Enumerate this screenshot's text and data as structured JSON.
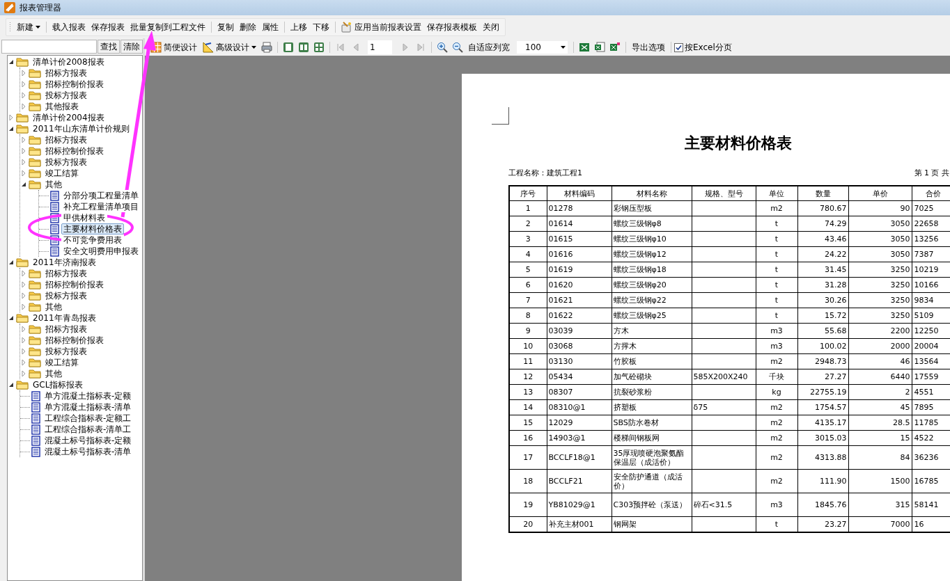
{
  "window": {
    "title": "报表管理器"
  },
  "toolbar": [
    [
      {
        "label": "新建",
        "kind": "menu"
      }
    ],
    [
      {
        "label": "载入报表",
        "kind": "text"
      },
      {
        "label": "保存报表",
        "kind": "text"
      },
      {
        "label": "批量复制到工程文件",
        "kind": "text"
      }
    ],
    [
      {
        "label": "复制",
        "kind": "text"
      },
      {
        "label": "删除",
        "kind": "text"
      },
      {
        "label": "属性",
        "kind": "text"
      }
    ],
    [
      {
        "label": "上移",
        "kind": "text"
      },
      {
        "label": "下移",
        "kind": "text"
      }
    ],
    [
      {
        "label": "应用当前报表设置",
        "kind": "icon"
      },
      {
        "label": "保存报表模板",
        "kind": "text"
      },
      {
        "label": "关闭",
        "kind": "text"
      }
    ]
  ],
  "search": {
    "find": "查找",
    "clear": "清除"
  },
  "tree": [
    {
      "label": "清单计价2008报表",
      "kind": "folder",
      "expanded": true,
      "selected": false,
      "children": [
        {
          "label": "招标方报表",
          "kind": "folder",
          "expanded": false,
          "selected": false
        },
        {
          "label": "招标控制价报表",
          "kind": "folder",
          "expanded": false,
          "selected": false
        },
        {
          "label": "投标方报表",
          "kind": "folder",
          "expanded": false,
          "selected": false
        },
        {
          "label": "其他报表",
          "kind": "folder",
          "expanded": false,
          "selected": false
        }
      ]
    },
    {
      "label": "清单计价2004报表",
      "kind": "folder",
      "expanded": false,
      "selected": false
    },
    {
      "label": "2011年山东清单计价规则",
      "kind": "folder",
      "expanded": true,
      "selected": false,
      "children": [
        {
          "label": "招标方报表",
          "kind": "folder",
          "expanded": false,
          "selected": false
        },
        {
          "label": "招标控制价报表",
          "kind": "folder",
          "expanded": false,
          "selected": false
        },
        {
          "label": "投标方报表",
          "kind": "folder",
          "expanded": false,
          "selected": false
        },
        {
          "label": "竣工结算",
          "kind": "folder",
          "expanded": false,
          "selected": false
        },
        {
          "label": "其他",
          "kind": "folder",
          "expanded": true,
          "selected": false,
          "children": [
            {
              "label": "分部分项工程量清单",
              "kind": "report",
              "selected": false
            },
            {
              "label": "补充工程量清单项目",
              "kind": "report",
              "selected": false
            },
            {
              "label": "甲供材料表",
              "kind": "report",
              "selected": false
            },
            {
              "label": "主要材料价格表",
              "kind": "report",
              "selected": true
            },
            {
              "label": "不可竞争费用表",
              "kind": "report",
              "selected": false
            },
            {
              "label": "安全文明费用申报表",
              "kind": "report",
              "selected": false
            }
          ]
        }
      ]
    },
    {
      "label": "2011年济南报表",
      "kind": "folder",
      "expanded": true,
      "selected": false,
      "children": [
        {
          "label": "招标方报表",
          "kind": "folder",
          "expanded": false,
          "selected": false
        },
        {
          "label": "招标控制价报表",
          "kind": "folder",
          "expanded": false,
          "selected": false
        },
        {
          "label": "投标方报表",
          "kind": "folder",
          "expanded": false,
          "selected": false
        },
        {
          "label": "其他",
          "kind": "folder",
          "expanded": false,
          "selected": false
        }
      ]
    },
    {
      "label": "2011年青岛报表",
      "kind": "folder",
      "expanded": true,
      "selected": false,
      "children": [
        {
          "label": "招标方报表",
          "kind": "folder",
          "expanded": false,
          "selected": false
        },
        {
          "label": "招标控制价报表",
          "kind": "folder",
          "expanded": false,
          "selected": false
        },
        {
          "label": "投标方报表",
          "kind": "folder",
          "expanded": false,
          "selected": false
        },
        {
          "label": "竣工结算",
          "kind": "folder",
          "expanded": false,
          "selected": false
        },
        {
          "label": "其他",
          "kind": "folder",
          "expanded": false,
          "selected": false
        }
      ]
    },
    {
      "label": "GCL指标报表",
      "kind": "folder",
      "expanded": true,
      "selected": false,
      "children": [
        {
          "label": "单方混凝土指标表-定额",
          "kind": "report",
          "selected": false
        },
        {
          "label": "单方混凝土指标表-清单",
          "kind": "report",
          "selected": false
        },
        {
          "label": "工程综合指标表-定额工",
          "kind": "report",
          "selected": false
        },
        {
          "label": "工程综合指标表-清单工",
          "kind": "report",
          "selected": false
        },
        {
          "label": "混凝土标号指标表-定额",
          "kind": "report",
          "selected": false
        },
        {
          "label": "混凝土标号指标表-清单",
          "kind": "report",
          "selected": false
        }
      ]
    }
  ],
  "preview_toolbar": {
    "simple_design": "简便设计",
    "advanced_design": "高级设计",
    "page_number": "1",
    "fit_columns": "自适应列宽",
    "zoom": "100",
    "export_options": "导出选项",
    "excel_paging": {
      "label": "按Excel分页",
      "checked": true
    }
  },
  "report": {
    "title": "主要材料价格表",
    "project": "工程名称：建筑工程1",
    "page_info": "第 1 页 共",
    "columns": [
      "序号",
      "材料编码",
      "材料名称",
      "规格、型号",
      "单位",
      "数量",
      "单价",
      "合价"
    ],
    "rows": [
      {
        "no": "1",
        "code": "01278",
        "name": "彩钢压型板",
        "unit": "m2",
        "qty": "780.67",
        "price": "90",
        "total": "7025"
      },
      {
        "no": "2",
        "code": "01614",
        "name": "螺纹三级钢φ8",
        "unit": "t",
        "qty": "74.29",
        "price": "3050",
        "total": "22658"
      },
      {
        "no": "3",
        "code": "01615",
        "name": "螺纹三级钢φ10",
        "unit": "t",
        "qty": "43.46",
        "price": "3050",
        "total": "13256"
      },
      {
        "no": "4",
        "code": "01616",
        "name": "螺纹三级钢φ12",
        "unit": "t",
        "qty": "24.22",
        "price": "3050",
        "total": "7387"
      },
      {
        "no": "5",
        "code": "01619",
        "name": "螺纹三级钢φ18",
        "unit": "t",
        "qty": "31.45",
        "price": "3250",
        "total": "10219"
      },
      {
        "no": "6",
        "code": "01620",
        "name": "螺纹三级钢φ20",
        "unit": "t",
        "qty": "31.28",
        "price": "3250",
        "total": "10166"
      },
      {
        "no": "7",
        "code": "01621",
        "name": "螺纹三级钢φ22",
        "unit": "t",
        "qty": "30.26",
        "price": "3250",
        "total": "9834"
      },
      {
        "no": "8",
        "code": "01622",
        "name": "螺纹三级钢φ25",
        "unit": "t",
        "qty": "15.72",
        "price": "3250",
        "total": "5109"
      },
      {
        "no": "9",
        "code": "03039",
        "name": "方木",
        "unit": "m3",
        "qty": "55.68",
        "price": "2200",
        "total": "12250"
      },
      {
        "no": "10",
        "code": "03068",
        "name": "方撑木",
        "unit": "m3",
        "qty": "100.02",
        "price": "2000",
        "total": "20004"
      },
      {
        "no": "11",
        "code": "03130",
        "name": "竹胶板",
        "unit": "m2",
        "qty": "2948.73",
        "price": "46",
        "total": "13564"
      },
      {
        "no": "12",
        "code": "05434",
        "name": "加气砼砌块",
        "spec": "585X200X240",
        "unit": "千块",
        "qty": "27.27",
        "price": "6440",
        "total": "17559"
      },
      {
        "no": "13",
        "code": "08307",
        "name": "抗裂砂浆粉",
        "unit": "kg",
        "qty": "22755.19",
        "price": "2",
        "total": "4551"
      },
      {
        "no": "14",
        "code": "08310@1",
        "name": "挤塑板",
        "spec": "δ75",
        "unit": "m2",
        "qty": "1754.57",
        "price": "45",
        "total": "7895"
      },
      {
        "no": "15",
        "code": "12029",
        "name": "SBS防水卷材",
        "unit": "m2",
        "qty": "4135.17",
        "price": "28.5",
        "total": "11785"
      },
      {
        "no": "16",
        "code": "14903@1",
        "name": "楼梯间钢板网",
        "unit": "m2",
        "qty": "3015.03",
        "price": "15",
        "total": "4522"
      },
      {
        "no": "17",
        "code": "BCCLF18@1",
        "name": "35厚现喷硬泡聚氨酯保温层（成活价）",
        "unit": "m2",
        "qty": "4313.88",
        "price": "84",
        "total": "36236"
      },
      {
        "no": "18",
        "code": "BCCLF21",
        "name": "安全防护通道（成活价）",
        "unit": "m2",
        "qty": "111.90",
        "price": "1500",
        "total": "16785"
      },
      {
        "no": "19",
        "code": "YB81029@1",
        "name": "C303预拌砼（泵送）",
        "spec": "碎石<31.5",
        "unit": "m3",
        "qty": "1845.76",
        "price": "315",
        "total": "58141"
      },
      {
        "no": "20",
        "code": "补充主材001",
        "name": "钢网架",
        "unit": "t",
        "qty": "23.27",
        "price": "7000",
        "total": "16"
      }
    ]
  }
}
